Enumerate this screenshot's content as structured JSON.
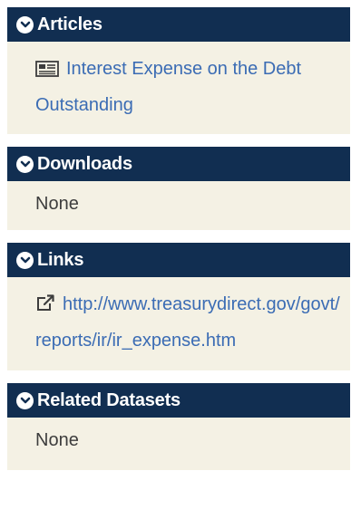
{
  "sections": {
    "articles": {
      "title": "Articles",
      "link_text": "Interest Expense on the Debt Outstanding"
    },
    "downloads": {
      "title": "Downloads",
      "value": "None"
    },
    "links": {
      "title": "Links",
      "link_text": "http://www.treasurydirect.gov/govt/reports/ir/ir_expense.htm"
    },
    "related": {
      "title": "Related Datasets",
      "value": "None"
    }
  },
  "icons": {
    "chevron": "chevron-down-circle-icon",
    "article": "newspaper-icon",
    "external": "external-link-icon"
  },
  "colors": {
    "header_bg": "#112e51",
    "panel_bg": "#f4f1e4",
    "link": "#3b6cb4",
    "text": "#3d3d3d"
  }
}
